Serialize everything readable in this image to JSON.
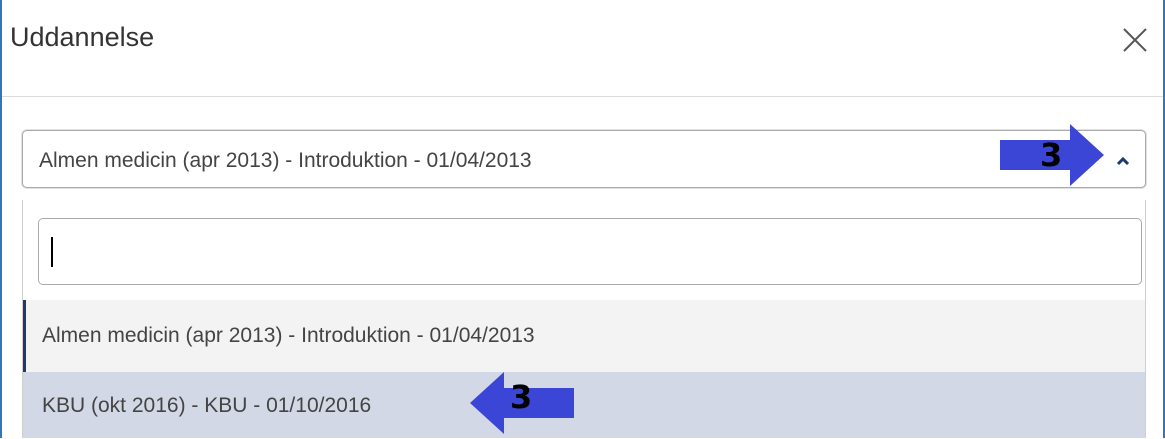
{
  "dialog": {
    "title": "Uddannelse",
    "close_icon": "close-icon"
  },
  "select": {
    "value": "Almen medicin (apr 2013) - Introduktion - 01/04/2013",
    "toggle_icon": "chevron-up-icon"
  },
  "search": {
    "value": "",
    "placeholder": ""
  },
  "options": [
    {
      "label": "Almen medicin (apr 2013) - Introduktion - 01/04/2013",
      "state": "selected"
    },
    {
      "label": "KBU (okt 2016) - KBU - 01/10/2016",
      "state": "hovered"
    }
  ],
  "annotations": [
    {
      "number": "3",
      "direction": "right",
      "color": "#3c46d6"
    },
    {
      "number": "3",
      "direction": "left",
      "color": "#3c46d6"
    }
  ],
  "colors": {
    "accent_border": "#2e78c0",
    "hover_bg": "#d2d8e6",
    "selected_marker": "#1f3870"
  }
}
